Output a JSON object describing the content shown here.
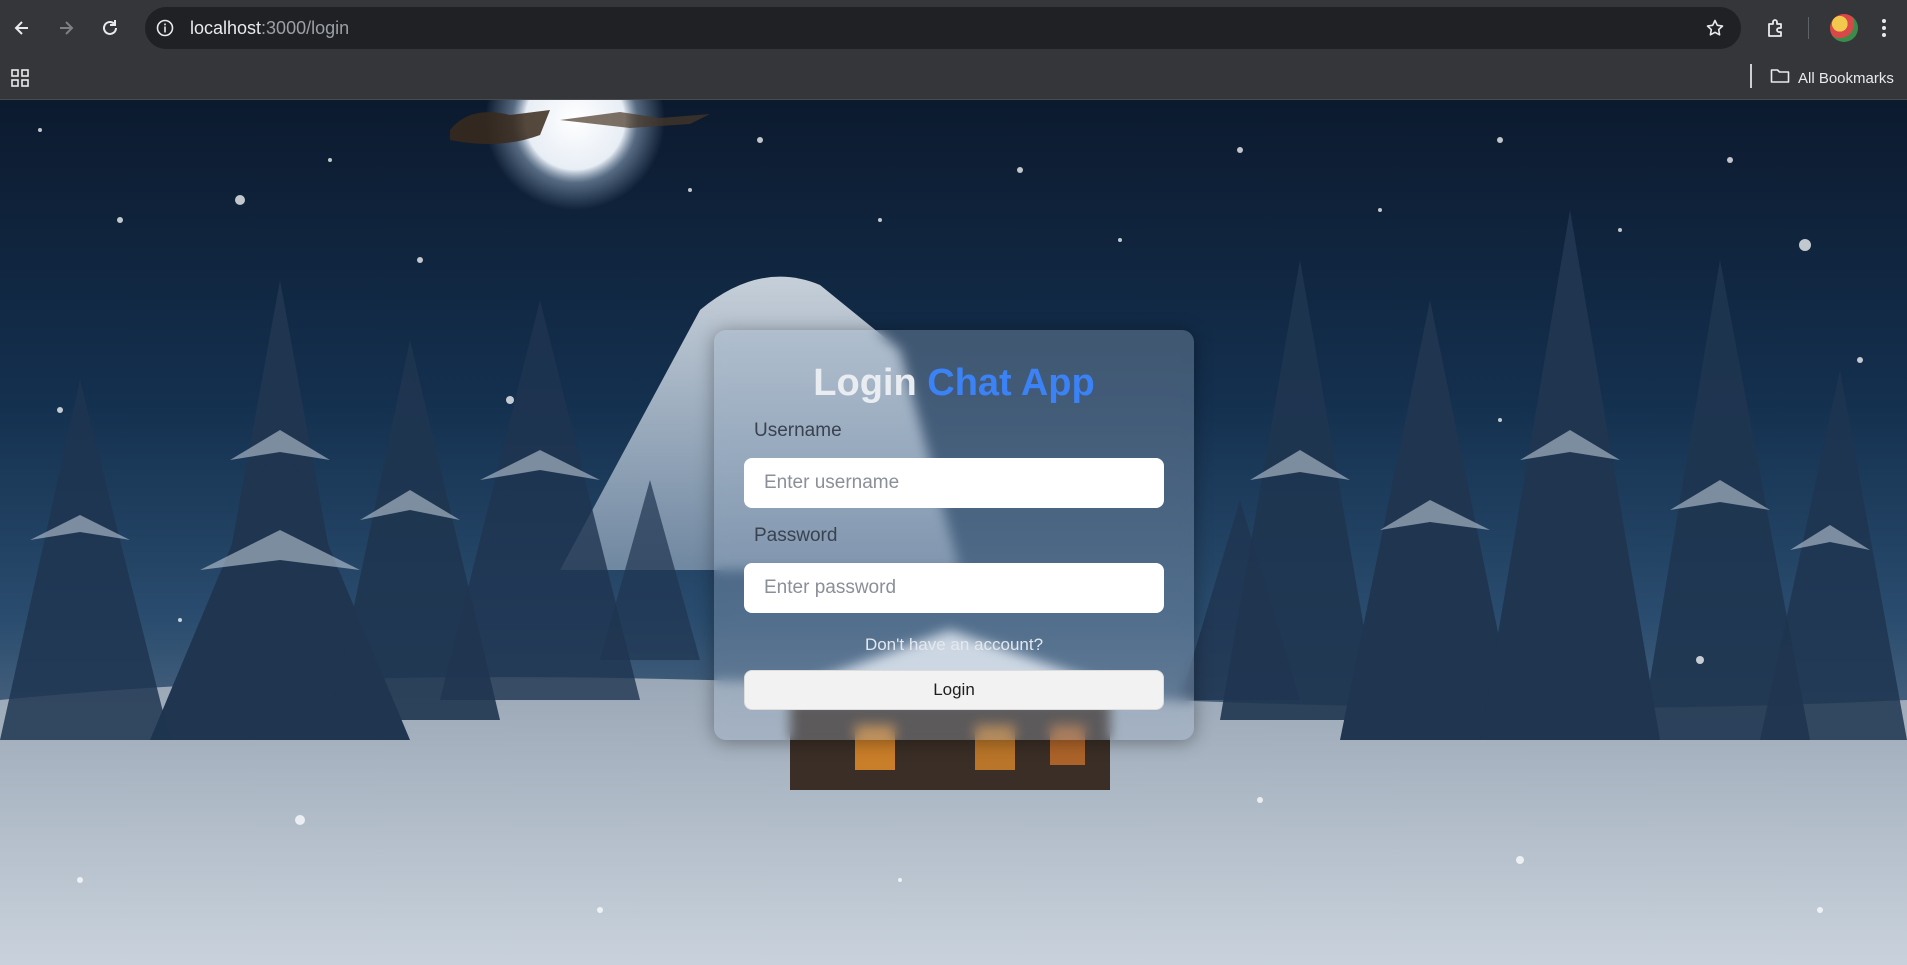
{
  "browser": {
    "url_host": "localhost",
    "url_path": ":3000/login",
    "bookmarks_label": "All Bookmarks"
  },
  "icons": {
    "back": "arrow-left-icon",
    "forward": "arrow-right-icon",
    "reload": "reload-icon",
    "site_info": "info-icon",
    "bookmark_star": "star-icon",
    "extensions": "puzzle-icon",
    "menu": "kebab-menu-icon",
    "apps": "apps-grid-icon",
    "folder": "folder-icon"
  },
  "login": {
    "title_main": "Login",
    "title_accent": "Chat App",
    "username_label": "Username",
    "username_placeholder": "Enter username",
    "password_label": "Password",
    "password_placeholder": "Enter password",
    "signup_link": "Don't have an account?",
    "login_button": "Login"
  },
  "colors": {
    "accent": "#3b82f6",
    "chrome_bg": "#35363a",
    "omnibox_bg": "#202124"
  }
}
